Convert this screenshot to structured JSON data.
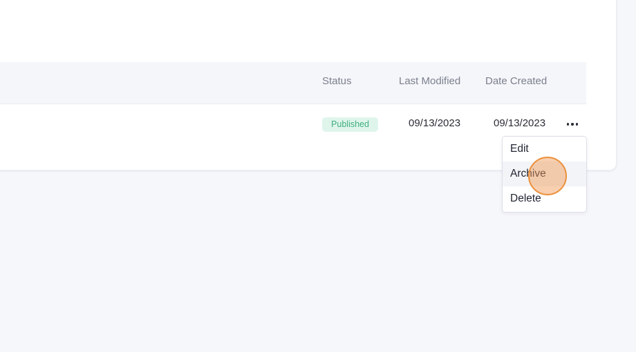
{
  "table": {
    "columns": {
      "status": "Status",
      "last_modified": "Last Modified",
      "date_created": "Date Created"
    },
    "rows": [
      {
        "status": "Published",
        "last_modified": "09/13/2023",
        "date_created": "09/13/2023",
        "actions_icon": "more-horizontal-icon"
      }
    ]
  },
  "actions_menu": {
    "items": [
      "Edit",
      "Archive",
      "Delete"
    ],
    "highlighted": "Archive"
  },
  "colors": {
    "status_published_bg": "#dff5ec",
    "status_published_text": "#3fae7e",
    "click_indicator": "#ec8f3a"
  }
}
